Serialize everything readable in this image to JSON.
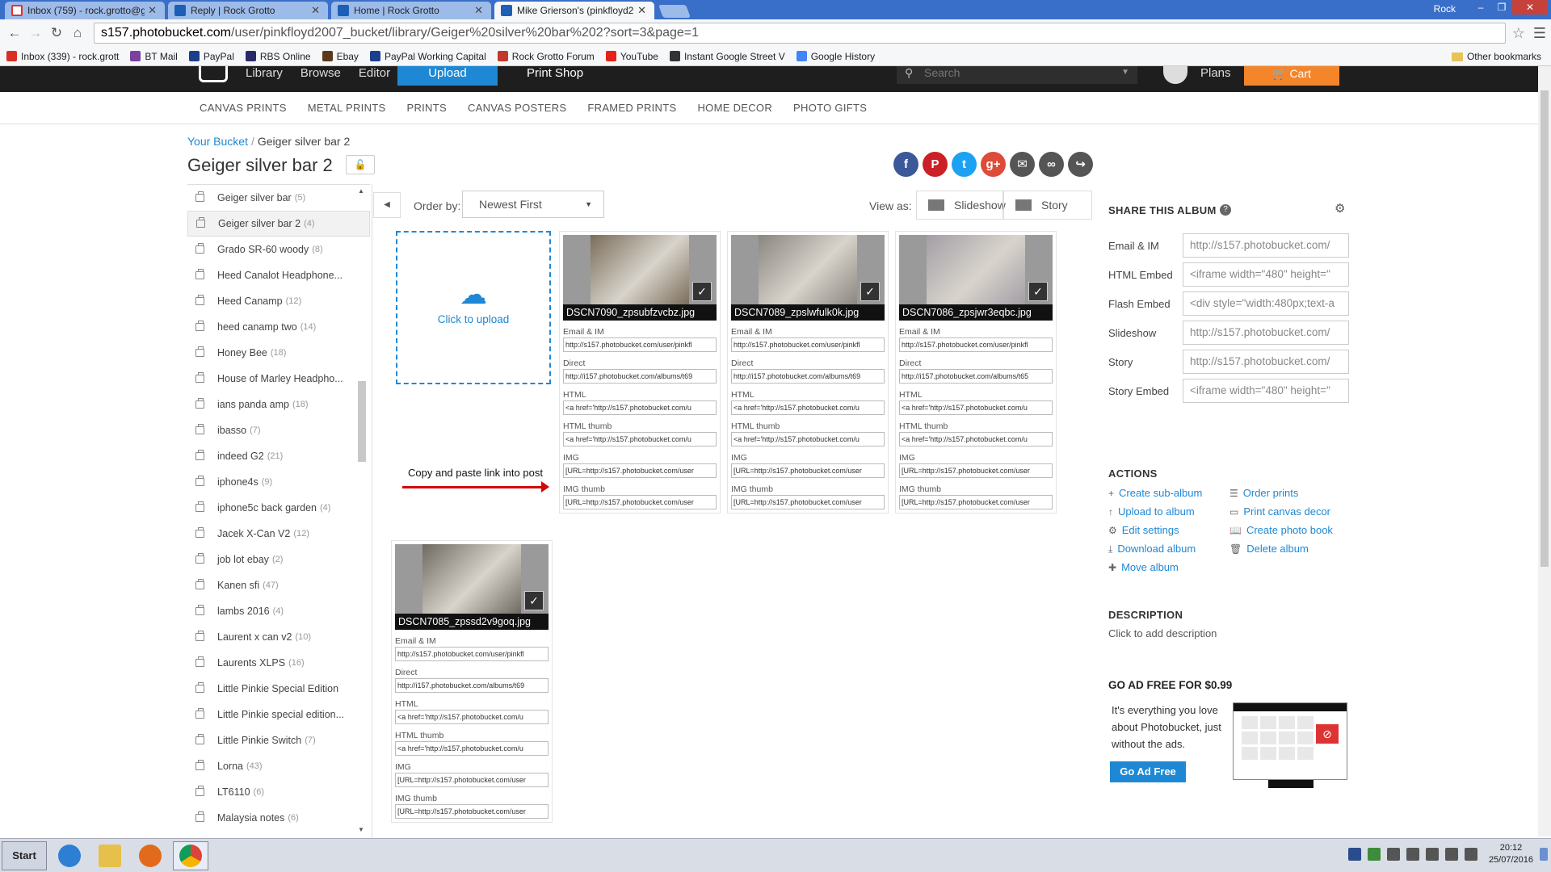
{
  "browser": {
    "tabs": [
      {
        "label": "Inbox (759) - rock.grotto@g",
        "active": false
      },
      {
        "label": "Reply | Rock Grotto",
        "active": false
      },
      {
        "label": "Home | Rock Grotto",
        "active": false
      },
      {
        "label": "Mike Grierson's (pinkfloyd20",
        "active": true
      }
    ],
    "window_user": "Rock",
    "url_domain": "s157.photobucket.com",
    "url_path": "/user/pinkfloyd2007_bucket/library/Geiger%20silver%20bar%202?sort=3&page=1",
    "bookmarks": [
      "Inbox (339) - rock.grott",
      "BT Mail",
      "PayPal",
      "RBS Online",
      "Ebay",
      "PayPal Working Capital",
      "Rock Grotto Forum",
      "YouTube",
      "Instant Google Street V",
      "Google History"
    ],
    "other_bookmarks": "Other bookmarks"
  },
  "header": {
    "nav": [
      "Library",
      "Browse",
      "Editor"
    ],
    "upload": "Upload",
    "print_shop": "Print Shop",
    "search_placeholder": "Search",
    "plans": "Plans",
    "cart": "Cart"
  },
  "subnav": [
    "CANVAS PRINTS",
    "METAL PRINTS",
    "PRINTS",
    "CANVAS POSTERS",
    "FRAMED PRINTS",
    "HOME DECOR",
    "PHOTO GIFTS"
  ],
  "breadcrumb": {
    "root": "Your Bucket",
    "sep": "/",
    "current": "Geiger silver bar 2"
  },
  "page_title": "Geiger silver bar 2",
  "social_colors": [
    "#3b5998",
    "#cb2027",
    "#1da1f2",
    "#dd4b39",
    "#555555",
    "#555555",
    "#555555"
  ],
  "albums": [
    {
      "name": "Geiger silver bar",
      "count": "(5)"
    },
    {
      "name": "Geiger silver bar 2",
      "count": "(4)",
      "selected": true
    },
    {
      "name": "Grado SR-60 woody",
      "count": "(8)"
    },
    {
      "name": "Heed Canalot Headphone...",
      "count": ""
    },
    {
      "name": "Heed Canamp",
      "count": "(12)"
    },
    {
      "name": "heed canamp two",
      "count": "(14)"
    },
    {
      "name": "Honey Bee",
      "count": "(18)"
    },
    {
      "name": "House of Marley Headpho...",
      "count": ""
    },
    {
      "name": "ians panda amp",
      "count": "(18)"
    },
    {
      "name": "ibasso",
      "count": "(7)"
    },
    {
      "name": "indeed G2",
      "count": "(21)"
    },
    {
      "name": "iphone4s",
      "count": "(9)"
    },
    {
      "name": "iphone5c back garden",
      "count": "(4)"
    },
    {
      "name": "Jacek X-Can V2",
      "count": "(12)"
    },
    {
      "name": "job lot ebay",
      "count": "(2)"
    },
    {
      "name": "Kanen sfi",
      "count": "(47)"
    },
    {
      "name": "lambs 2016",
      "count": "(4)"
    },
    {
      "name": "Laurent x can v2",
      "count": "(10)"
    },
    {
      "name": "Laurents XLPS",
      "count": "(16)"
    },
    {
      "name": "Little Pinkie Special Edition",
      "count": ""
    },
    {
      "name": "Little Pinkie special edition...",
      "count": ""
    },
    {
      "name": "Little Pinkie Switch",
      "count": "(7)"
    },
    {
      "name": "Lorna",
      "count": "(43)"
    },
    {
      "name": "LT6110",
      "count": "(6)"
    },
    {
      "name": "Malaysia notes",
      "count": "(6)"
    }
  ],
  "toolbar": {
    "order_label": "Order by:",
    "order_value": "Newest First",
    "view_label": "View as:",
    "slideshow": "Slideshow",
    "story": "Story"
  },
  "upload_box": {
    "label": "Click to upload"
  },
  "annotation": "Copy and paste link into post",
  "field_labels": [
    "Email & IM",
    "Direct",
    "HTML",
    "HTML thumb",
    "IMG",
    "IMG thumb"
  ],
  "photos": [
    {
      "filename": "DSCN7090_zpsubfzvcbz.jpg",
      "tone": "#7b6d5a",
      "fields": [
        "http://s157.photobucket.com/user/pinkfl",
        "http://i157.photobucket.com/albums/t69",
        "<a href='http://s157.photobucket.com/u",
        "<a href='http://s157.photobucket.com/u",
        "[URL=http://s157.photobucket.com/user",
        "[URL=http://s157.photobucket.com/user"
      ]
    },
    {
      "filename": "DSCN7089_zpslwfulk0k.jpg",
      "tone": "#8a8680",
      "fields": [
        "http://s157.photobucket.com/user/pinkfl",
        "http://i157.photobucket.com/albums/t69",
        "<a href='http://s157.photobucket.com/u",
        "<a href='http://s157.photobucket.com/u",
        "[URL=http://s157.photobucket.com/user",
        "[URL=http://s157.photobucket.com/user"
      ]
    },
    {
      "filename": "DSCN7086_zpsjwr3eqbc.jpg",
      "tone": "#a39ea6",
      "fields": [
        "http://s157.photobucket.com/user/pinkfl",
        "http://i157.photobucket.com/albums/t65",
        "<a href='http://s157.photobucket.com/u",
        "<a href='http://s157.photobucket.com/u",
        "[URL=http://s157.photobucket.com/user",
        "[URL=http://s157.photobucket.com/user"
      ]
    },
    {
      "filename": "DSCN7085_zpssd2v9goq.jpg",
      "tone": "#6e6a62",
      "fields": [
        "http://s157.photobucket.com/user/pinkfl",
        "http://i157.photobucket.com/albums/t69",
        "<a href='http://s157.photobucket.com/u",
        "<a href='http://s157.photobucket.com/u",
        "[URL=http://s157.photobucket.com/user",
        "[URL=http://s157.photobucket.com/user"
      ]
    }
  ],
  "share": {
    "title": "SHARE THIS ALBUM",
    "rows": [
      {
        "label": "Email & IM",
        "value": "http://s157.photobucket.com/"
      },
      {
        "label": "HTML Embed",
        "value": "<iframe width=\"480\" height=\""
      },
      {
        "label": "Flash Embed",
        "value": "<div style=\"width:480px;text-a"
      },
      {
        "label": "Slideshow",
        "value": "http://s157.photobucket.com/"
      },
      {
        "label": "Story",
        "value": "http://s157.photobucket.com/"
      },
      {
        "label": "Story Embed",
        "value": "<iframe width=\"480\" height=\""
      }
    ]
  },
  "actions": {
    "title": "ACTIONS",
    "left": [
      "Create sub-album",
      "Upload to album",
      "Edit settings",
      "Download album",
      "Move album"
    ],
    "right": [
      "Order prints",
      "Print canvas decor",
      "Create photo book",
      "Delete album"
    ]
  },
  "description": {
    "title": "DESCRIPTION",
    "text": "Click to add description"
  },
  "adfree": {
    "title": "GO AD FREE FOR $0.99",
    "text": "It's everything you love about Photobucket, just without the ads.",
    "button": "Go Ad Free"
  },
  "taskbar": {
    "start": "Start",
    "time": "20:12",
    "date": "25/07/2016"
  }
}
